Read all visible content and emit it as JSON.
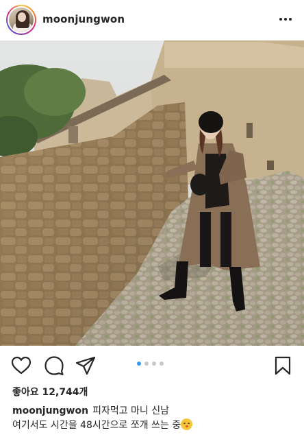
{
  "post": {
    "username": "moonjungwon",
    "likes_text": "좋아요 12,744개",
    "caption_user": "moonjungwon",
    "caption_line1": "피자먹고  마니 신남",
    "caption_line2": "여기서도 시간을 48시간으로 쪼개 쓰는 중",
    "caption_emoji": "face-blowing-kiss-emoji",
    "carousel_total": 4,
    "carousel_active": 1
  },
  "icons": {
    "more": "more-options-icon",
    "like": "heart-icon",
    "comment": "comment-icon",
    "share": "paper-plane-icon",
    "save": "bookmark-icon"
  },
  "colors": {
    "text": "#262626",
    "dot_active": "#3897f0",
    "dot_inactive": "#c7c7c7"
  }
}
